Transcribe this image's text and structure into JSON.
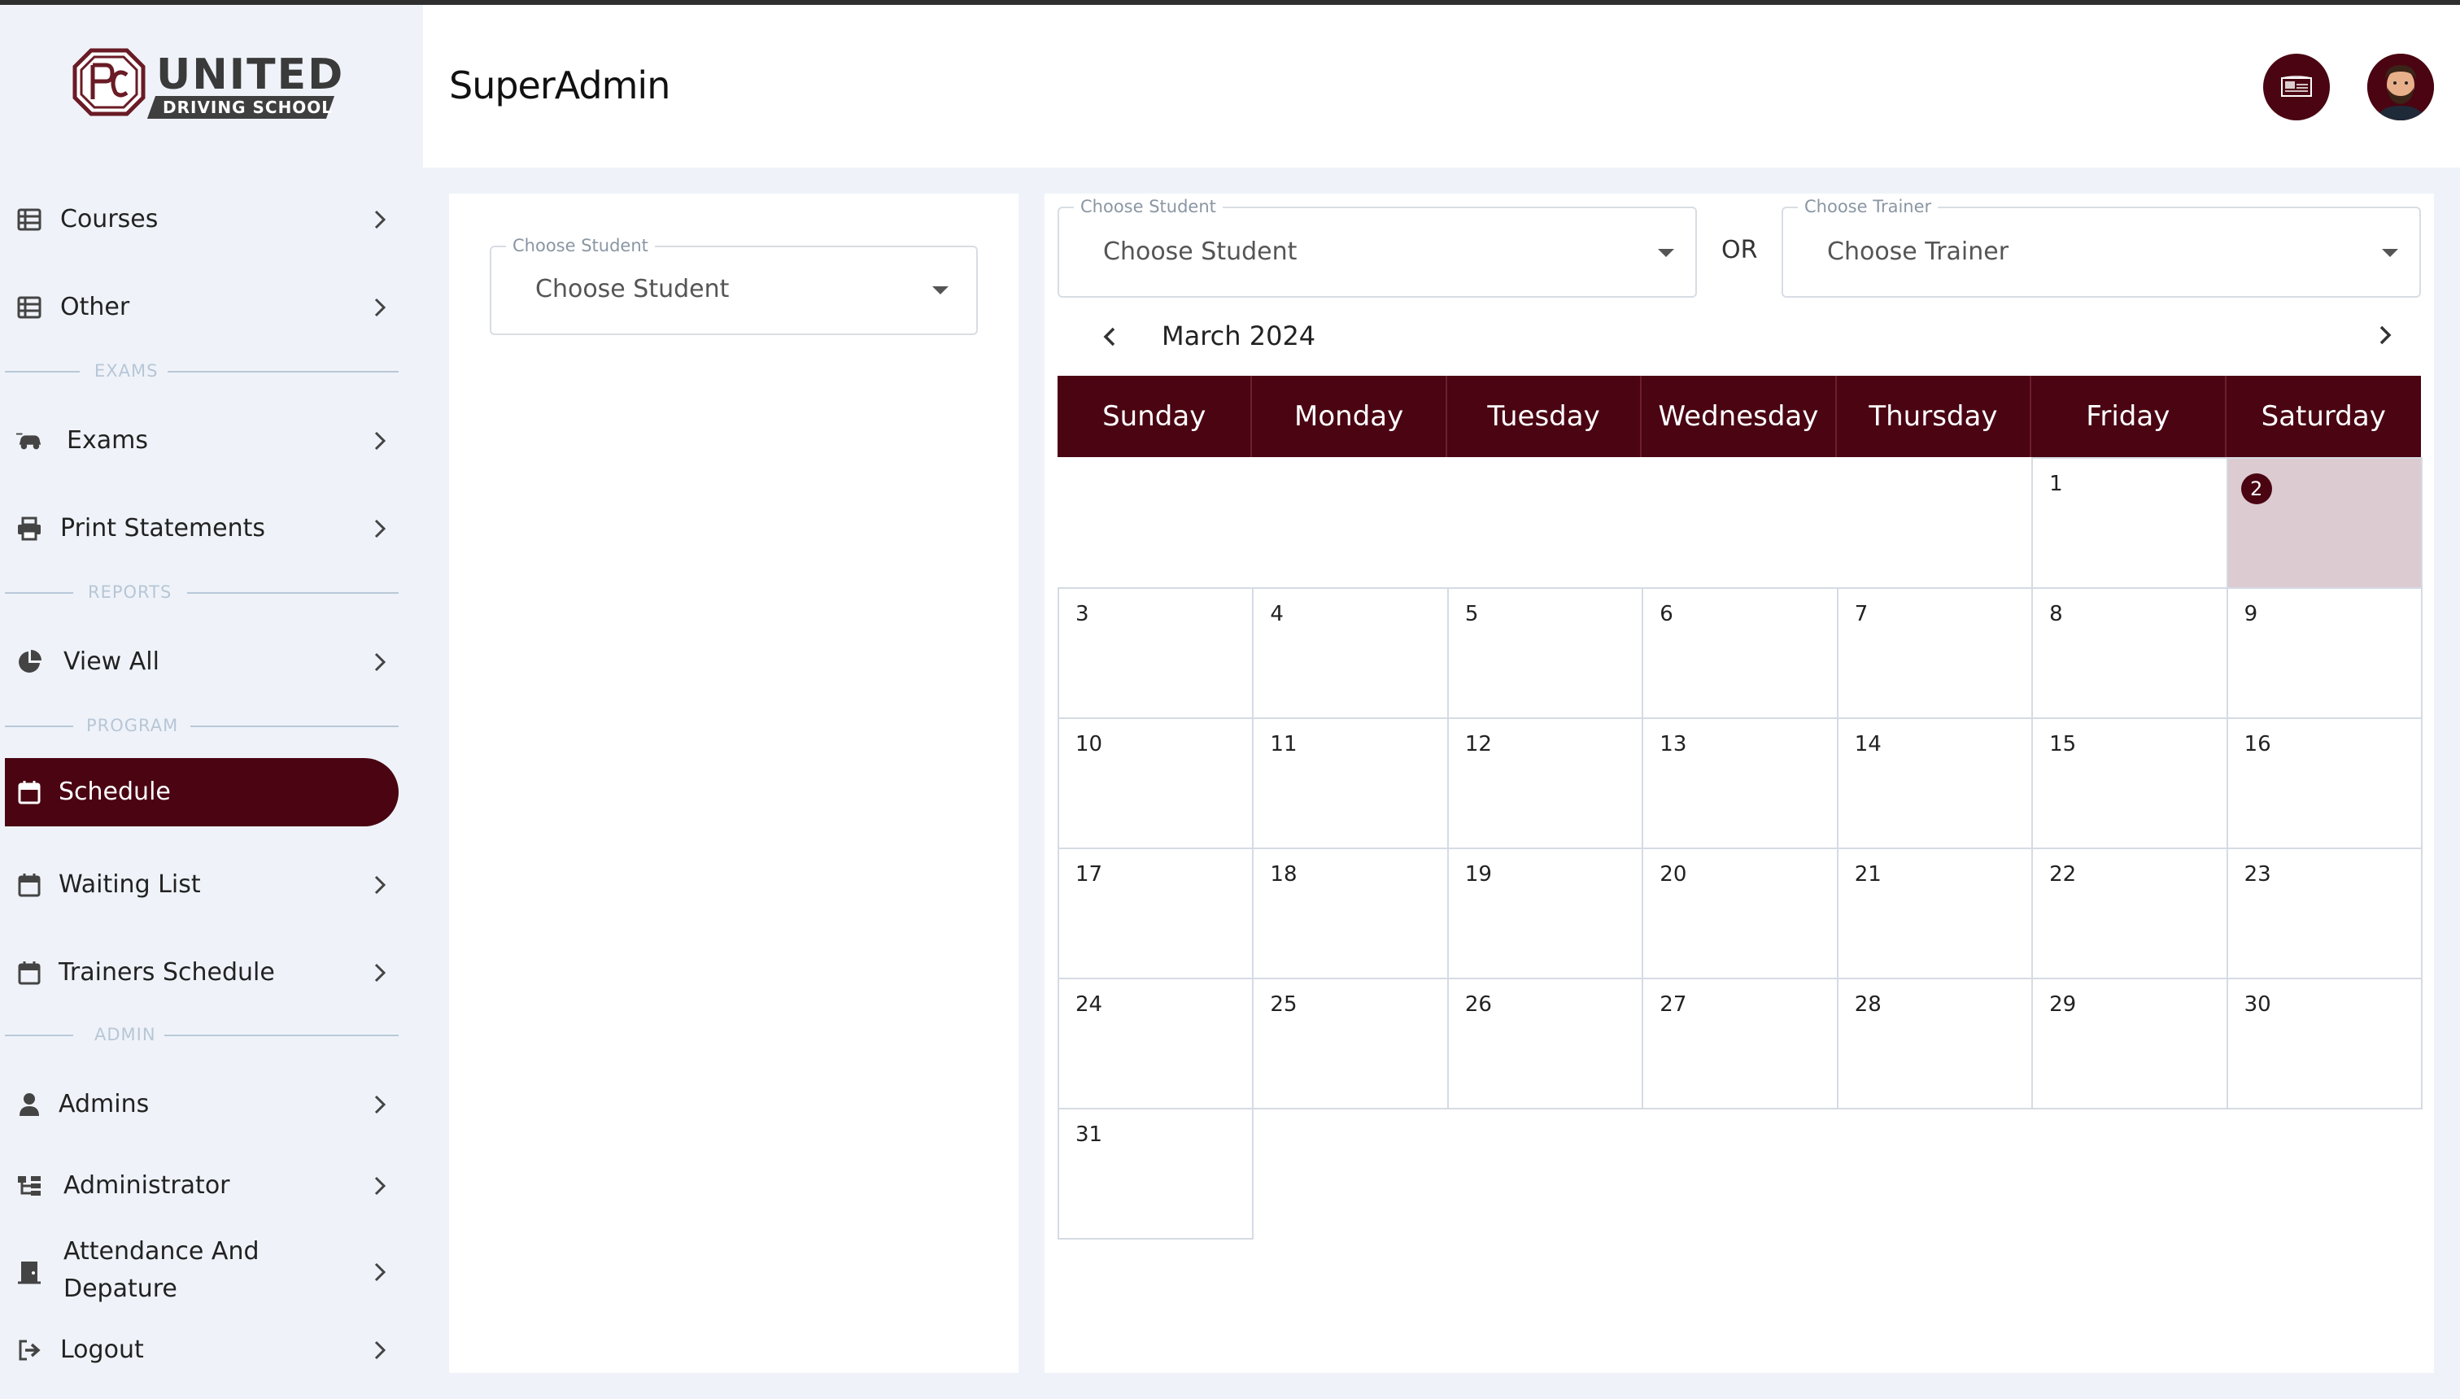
{
  "brand": {
    "name_line1": "UNITED",
    "name_line2": "DRIVING SCHOOL"
  },
  "header": {
    "title": "SuperAdmin"
  },
  "sidebar": {
    "items": [
      {
        "label": "Courses",
        "icon": "table-icon"
      },
      {
        "label": "Other",
        "icon": "table-icon"
      },
      {
        "label": "Exams",
        "icon": "car-icon"
      },
      {
        "label": "Print Statements",
        "icon": "printer-icon"
      },
      {
        "label": "View All",
        "icon": "pie-chart-icon"
      },
      {
        "label": "Schedule",
        "icon": "calendar-icon",
        "active": true
      },
      {
        "label": "Waiting List",
        "icon": "calendar-icon"
      },
      {
        "label": "Trainers Schedule",
        "icon": "calendar-icon"
      },
      {
        "label": "Admins",
        "icon": "user-icon"
      },
      {
        "label": "Administrator",
        "icon": "org-icon"
      },
      {
        "label": "Attendance And",
        "label2": "Depature",
        "icon": "door-icon"
      },
      {
        "label": "Logout",
        "icon": "logout-icon"
      }
    ],
    "sections": {
      "exams": "EXAMS",
      "reports": "REPORTS",
      "program": "PROGRAM",
      "admin": "ADMIN"
    }
  },
  "left_panel": {
    "student_select": {
      "legend": "Choose Student",
      "value": "Choose Student"
    }
  },
  "right_panel": {
    "student_select": {
      "legend": "Choose Student",
      "value": "Choose Student"
    },
    "or_label": "OR",
    "trainer_select": {
      "legend": "Choose Trainer",
      "value": "Choose Trainer"
    }
  },
  "calendar": {
    "title": "March 2024",
    "weekdays": [
      "Sunday",
      "Monday",
      "Tuesday",
      "Wednesday",
      "Thursday",
      "Friday",
      "Saturday"
    ],
    "days": [
      "1",
      "2",
      "3",
      "4",
      "5",
      "6",
      "7",
      "8",
      "9",
      "10",
      "11",
      "12",
      "13",
      "14",
      "15",
      "16",
      "17",
      "18",
      "19",
      "20",
      "21",
      "22",
      "23",
      "24",
      "25",
      "26",
      "27",
      "28",
      "29",
      "30",
      "31"
    ],
    "first_weekday_index": 5,
    "today_index": 1
  },
  "colors": {
    "accent": "#4a0412",
    "today_bg": "#dccbd0",
    "sidebar_bg": "#eff3f9"
  }
}
